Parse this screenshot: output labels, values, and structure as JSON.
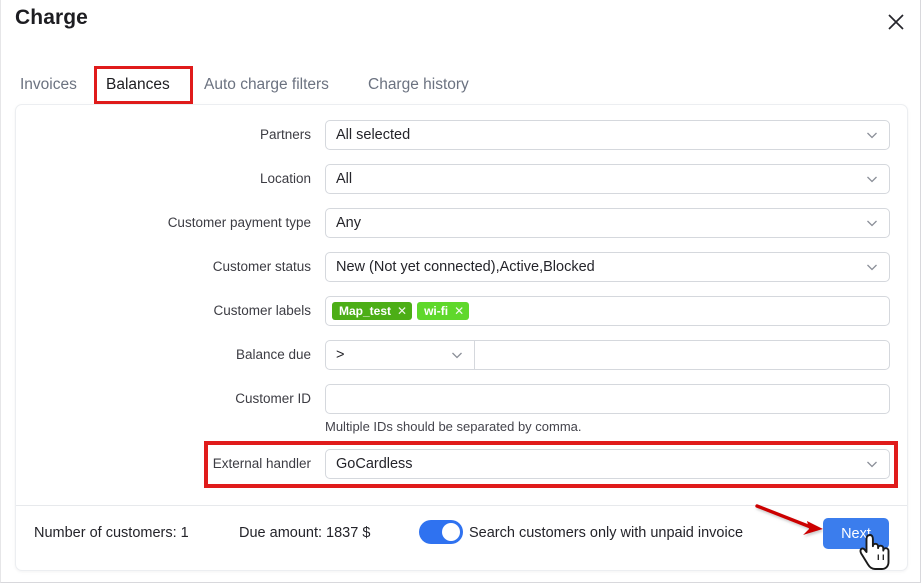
{
  "dialog": {
    "title": "Charge",
    "close_icon": "close-icon"
  },
  "tabs": [
    {
      "label": "Invoices",
      "active": false
    },
    {
      "label": "Balances",
      "active": true
    },
    {
      "label": "Auto charge filters",
      "active": false
    },
    {
      "label": "Charge history",
      "active": false
    }
  ],
  "form": {
    "partners": {
      "label": "Partners",
      "value": "All selected"
    },
    "location": {
      "label": "Location",
      "value": "All"
    },
    "customer_payment_type": {
      "label": "Customer payment type",
      "value": "Any"
    },
    "customer_status": {
      "label": "Customer status",
      "value": "New (Not yet connected),Active,Blocked"
    },
    "customer_labels": {
      "label": "Customer labels",
      "chips": [
        {
          "text": "Map_test",
          "color": "#4cae16",
          "remove_icon": "✕"
        },
        {
          "text": "wi-fi",
          "color": "#5fd82b",
          "remove_icon": "✕"
        }
      ]
    },
    "balance_due": {
      "label": "Balance due",
      "operator": ">",
      "amount": "",
      "amount_placeholder": ""
    },
    "customer_id": {
      "label": "Customer ID",
      "value": "",
      "placeholder": "",
      "helper": "Multiple IDs should be separated by comma."
    },
    "external_handler": {
      "label": "External handler",
      "value": "GoCardless"
    }
  },
  "footer": {
    "number_of_customers": "Number of customers: 1",
    "due_amount": "Due amount: 1837 $",
    "toggle_label": "Search customers only with unpaid invoice",
    "toggle_on": true,
    "next_label": "Next"
  },
  "annotations": {
    "highlight_color": "#e01b1b",
    "arrow_color": "#cc0000"
  }
}
